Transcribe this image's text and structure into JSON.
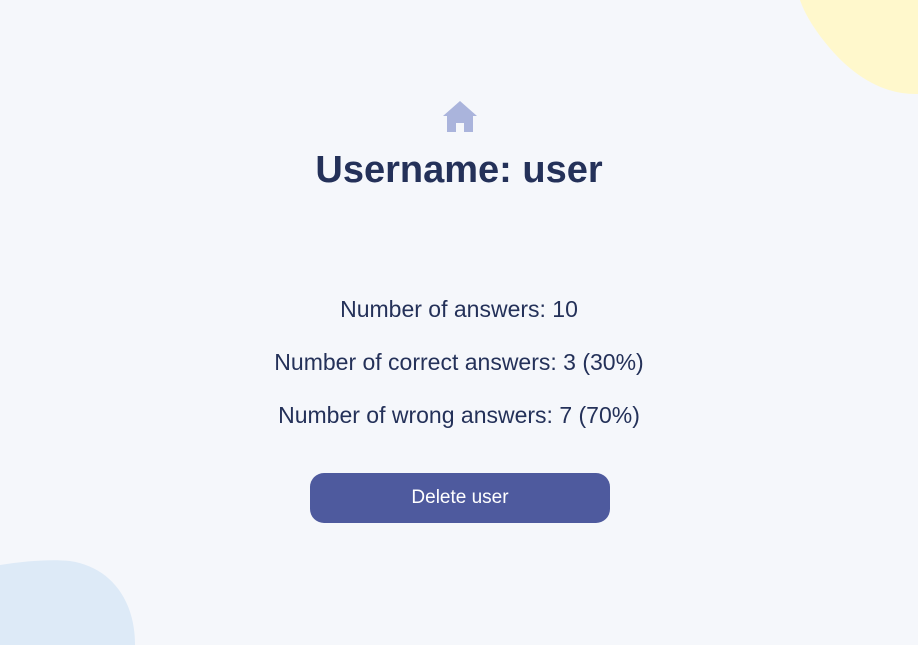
{
  "header": {
    "home_icon": "home-icon",
    "title": "Username: user"
  },
  "stats": {
    "answers": "Number of answers: 10",
    "correct": "Number of correct answers: 3 (30%)",
    "wrong": "Number of wrong answers: 7 (70%)"
  },
  "actions": {
    "delete_label": "Delete user"
  },
  "colors": {
    "background": "#f5f7fb",
    "text": "#243159",
    "icon": "#aab4dc",
    "button": "#4e5a9e",
    "blob_top_right": "#fff8cc",
    "blob_bottom_left": "#ddeaf7"
  }
}
